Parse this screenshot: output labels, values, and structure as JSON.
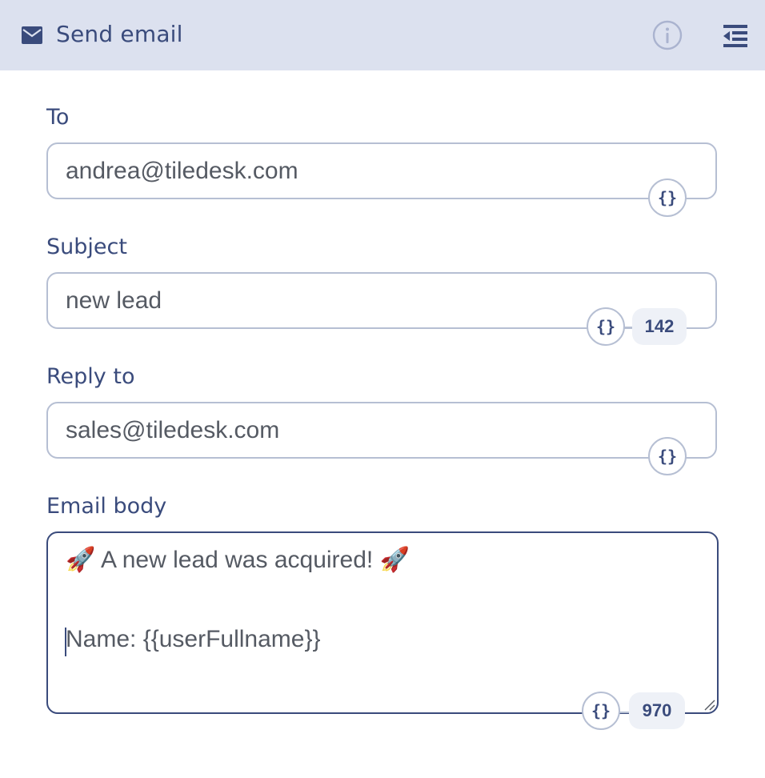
{
  "header": {
    "title": "Send email",
    "icons": {
      "mail": "mail-icon",
      "info": "info-icon",
      "collapse": "collapse-panel-icon"
    }
  },
  "fields": {
    "to": {
      "label": "To",
      "value": "andrea@tiledesk.com",
      "var_button": "{}"
    },
    "subject": {
      "label": "Subject",
      "value": "new lead",
      "var_button": "{}",
      "counter": "142"
    },
    "reply_to": {
      "label": "Reply to",
      "value": "sales@tiledesk.com",
      "var_button": "{}"
    },
    "body": {
      "label": "Email body",
      "line1": "🚀 A new lead was acquired! 🚀",
      "line2": "Name: {{userFullname}}",
      "var_button": "{}",
      "counter": "970"
    }
  },
  "colors": {
    "header_bg": "#dce1ef",
    "accent": "#3a4b7c",
    "border": "#b6bfd3",
    "text": "#555a63"
  }
}
